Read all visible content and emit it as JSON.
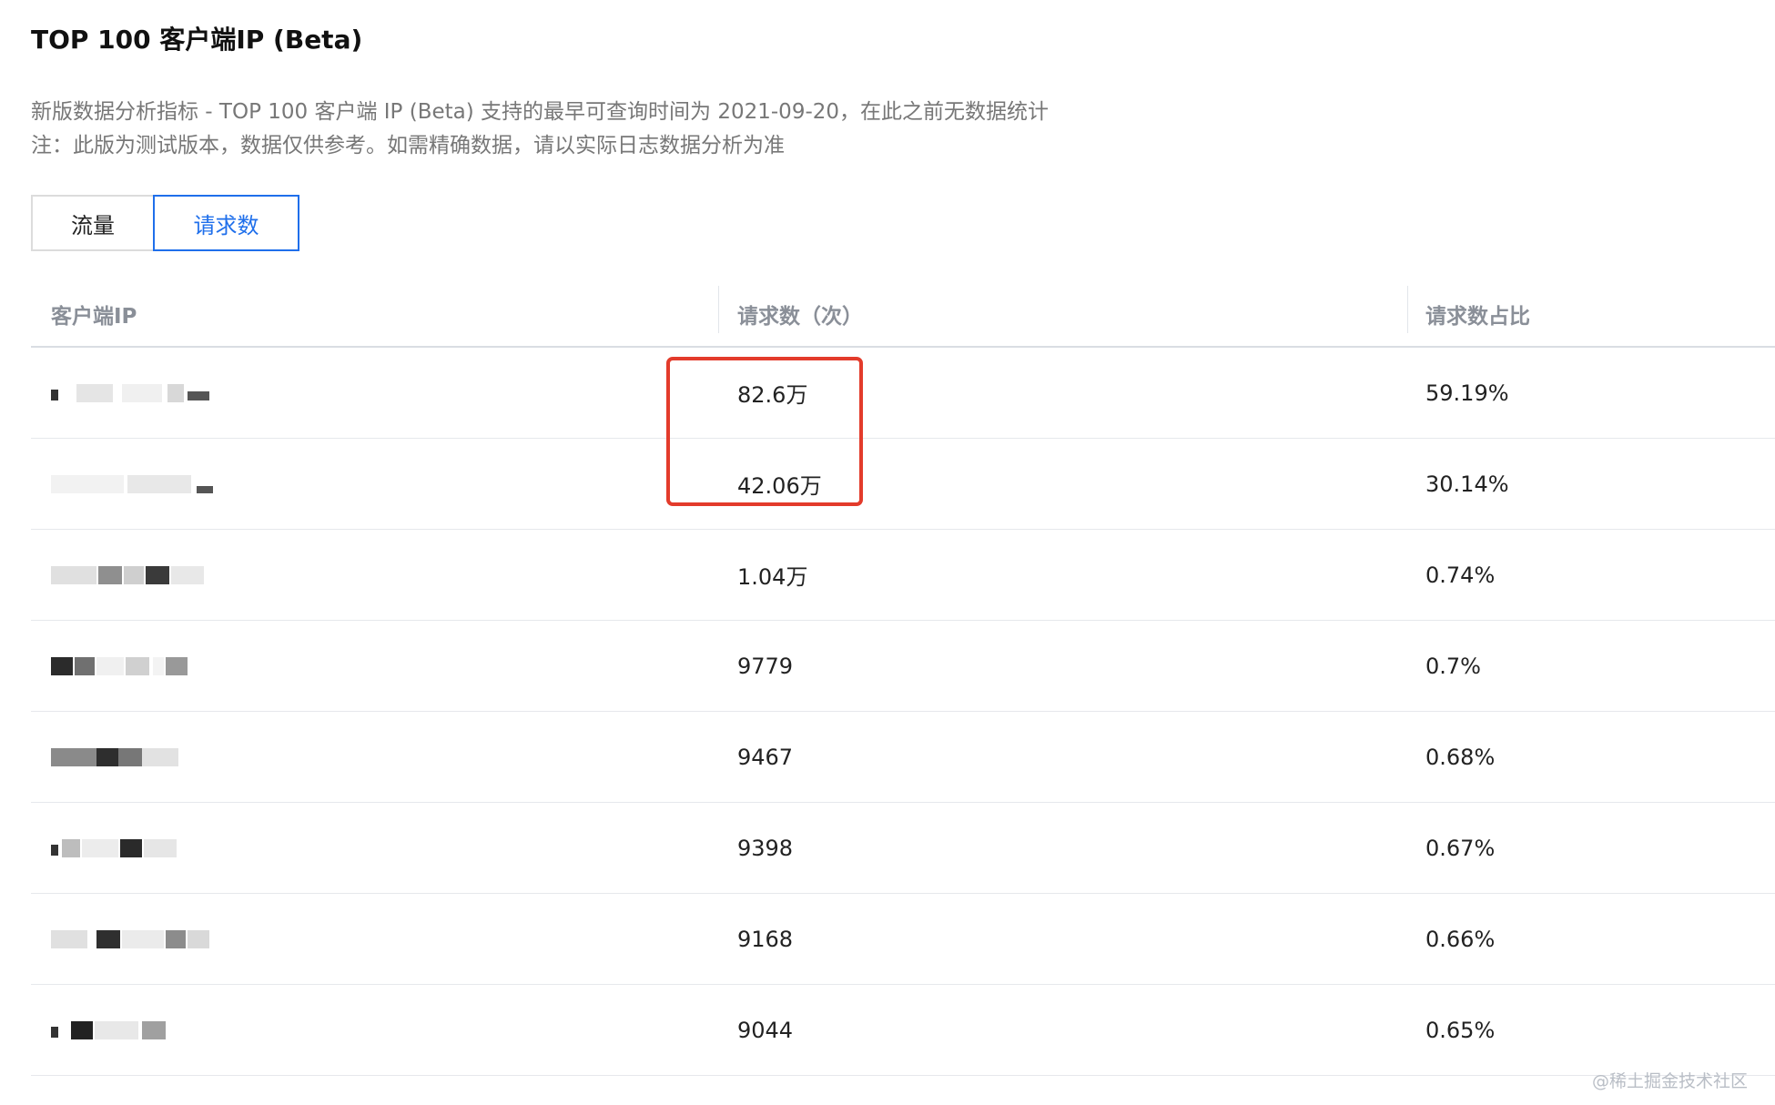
{
  "header": {
    "title": "TOP 100 客户端IP (Beta)",
    "desc_line1": "新版数据分析指标 - TOP 100 客户端 IP (Beta) 支持的最早可查询时间为 2021-09-20，在此之前无数据统计",
    "desc_line2": "注：此版为测试版本，数据仅供参考。如需精确数据，请以实际日志数据分析为准"
  },
  "tabs": {
    "traffic": "流量",
    "requests": "请求数",
    "active": "requests"
  },
  "table": {
    "columns": [
      "客户端IP",
      "请求数（次）",
      "请求数占比"
    ],
    "rows": [
      {
        "ip": "",
        "requests": "82.6万",
        "ratio": "59.19%"
      },
      {
        "ip": "",
        "requests": "42.06万",
        "ratio": "30.14%"
      },
      {
        "ip": "",
        "requests": "1.04万",
        "ratio": "0.74%"
      },
      {
        "ip": "",
        "requests": "9779",
        "ratio": "0.7%"
      },
      {
        "ip": "",
        "requests": "9467",
        "ratio": "0.68%"
      },
      {
        "ip": "",
        "requests": "9398",
        "ratio": "0.67%"
      },
      {
        "ip": "",
        "requests": "9168",
        "ratio": "0.66%"
      },
      {
        "ip": "",
        "requests": "9044",
        "ratio": "0.65%"
      }
    ]
  },
  "highlight_color": "#e33b2b",
  "accent_color": "#1f6feb",
  "watermark": "@稀土掘金技术社区"
}
